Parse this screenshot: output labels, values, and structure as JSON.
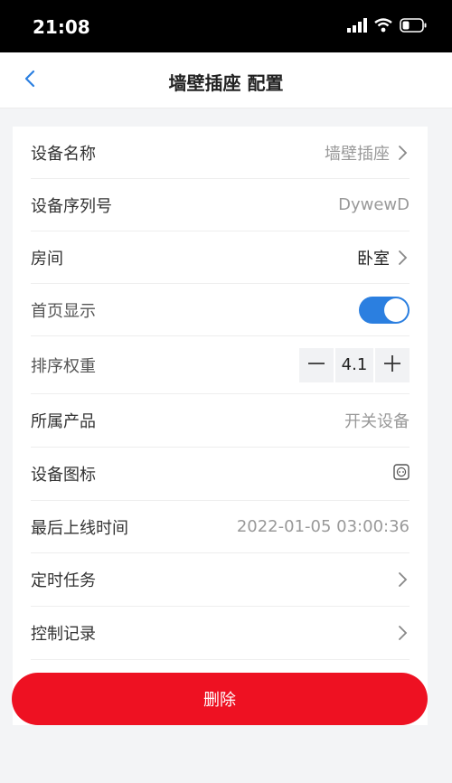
{
  "status_bar": {
    "time": "21:08",
    "icons": [
      "signal-icon",
      "wifi-icon",
      "battery-icon"
    ]
  },
  "header": {
    "title": "墙壁插座 配置",
    "back_icon": "chevron-left-icon"
  },
  "rows": [
    {
      "label": "设备名称",
      "value": "墙壁插座",
      "type": "link"
    },
    {
      "label": "设备序列号",
      "value": "DywewD",
      "type": "text"
    },
    {
      "label": "房间",
      "value": "卧室",
      "type": "link"
    },
    {
      "label": "首页显示",
      "type": "toggle",
      "on": true
    },
    {
      "label": "排序权重",
      "type": "stepper",
      "value": "4.1"
    },
    {
      "label": "所属产品",
      "value": "开关设备",
      "type": "text"
    },
    {
      "label": "设备图标",
      "type": "icon",
      "icon": "socket-icon"
    },
    {
      "label": "最后上线时间",
      "value": "2022-01-05 03:00:36",
      "type": "text"
    },
    {
      "label": "定时任务",
      "type": "link"
    },
    {
      "label": "控制记录",
      "type": "link"
    }
  ],
  "delete_button": {
    "label": "删除"
  },
  "colors": {
    "accent": "#2b7fe0",
    "danger": "#ee1122",
    "background": "#f3f4f6"
  }
}
